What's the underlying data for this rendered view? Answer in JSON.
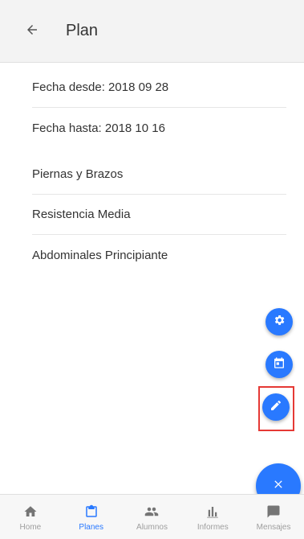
{
  "appbar": {
    "title": "Plan",
    "back_icon": "arrow-left-icon"
  },
  "details": {
    "date_from": "Fecha desde: 2018 09 28",
    "date_to": "Fecha hasta: 2018 10 16"
  },
  "exercises": [
    {
      "label": "Piernas y Brazos"
    },
    {
      "label": "Resistencia Media"
    },
    {
      "label": "Abdominales Principiante"
    }
  ],
  "fab": {
    "settings_icon": "gear-icon",
    "calendar_icon": "calendar-icon",
    "edit_icon": "pencil-icon",
    "close_icon": "close-icon",
    "color": "#2979ff"
  },
  "bottom_nav": {
    "items": [
      {
        "label": "Home",
        "icon": "home-icon",
        "active": false
      },
      {
        "label": "Planes",
        "icon": "clipboard-icon",
        "active": true
      },
      {
        "label": "Alumnos",
        "icon": "people-icon",
        "active": false
      },
      {
        "label": "Informes",
        "icon": "bar-chart-icon",
        "active": false
      },
      {
        "label": "Mensajes",
        "icon": "message-icon",
        "active": false
      }
    ]
  }
}
